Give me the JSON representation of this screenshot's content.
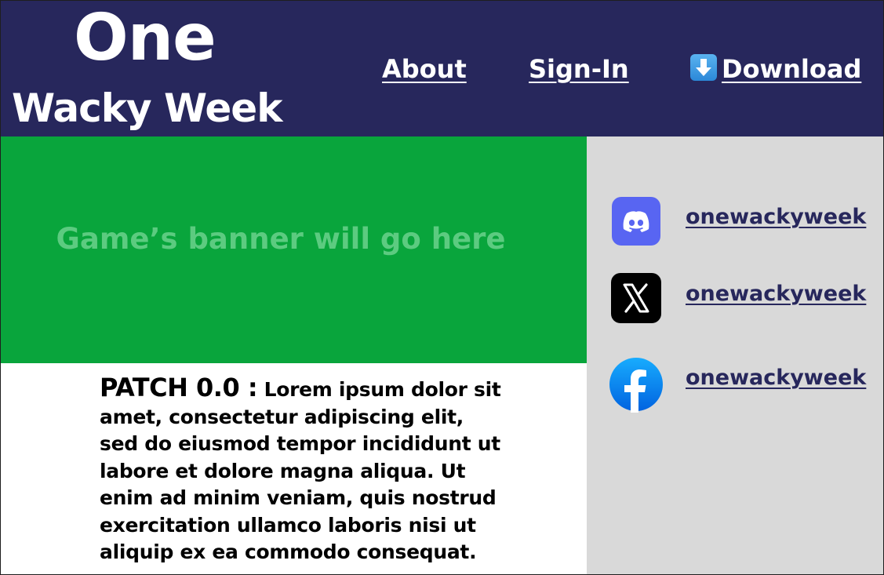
{
  "header": {
    "logo_line1": "One",
    "logo_line2": "Wacky Week",
    "nav": {
      "about": "About",
      "signin": "Sign-In",
      "download": "Download"
    }
  },
  "banner": {
    "placeholder_text": "Game’s banner will go here"
  },
  "sidebar": {
    "socials": [
      {
        "platform": "discord",
        "handle": "onewackyweek",
        "color": "#5865f2"
      },
      {
        "platform": "x",
        "handle": "onewackyweek",
        "color": "#000000"
      },
      {
        "platform": "facebook",
        "handle": "onewackyweek",
        "color": "#1877f2"
      }
    ]
  },
  "patch": {
    "title": "PATCH 0.0 :",
    "body": "Lorem ipsum dolor sit amet, consectetur adipiscing elit, sed do eiusmod tempor incididunt ut labore et dolore magna aliqua. Ut enim ad minim veniam, quis nostrud exercitation ullamco laboris nisi ut aliquip ex ea commodo consequat."
  },
  "colors": {
    "header_bg": "#27275c",
    "banner_bg": "#09a53c",
    "banner_text": "#5ccb80",
    "sidebar_bg": "#d9d9d9",
    "link": "#27275c"
  }
}
